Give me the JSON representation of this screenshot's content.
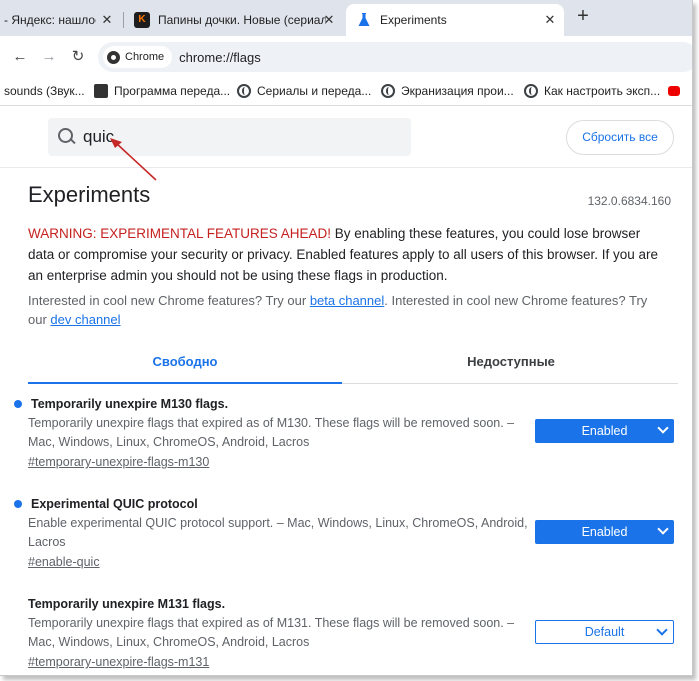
{
  "tabs": [
    {
      "title": "- Яндекс: нашлось",
      "favicon": "yandex-icon"
    },
    {
      "title": "Папины дочки. Новые (сериал",
      "favicon": "kinopoisk-icon"
    },
    {
      "title": "Experiments",
      "favicon": "flask-icon",
      "active": true
    }
  ],
  "toolbar": {
    "chip_label": "Chrome",
    "url": "chrome://flags"
  },
  "bookmarks": [
    {
      "label": "sounds (Звук...",
      "icon": "none"
    },
    {
      "label": "Программа переда...",
      "icon": "tv-icon"
    },
    {
      "label": "Сериалы и переда...",
      "icon": "globe-icon"
    },
    {
      "label": "Экранизация прои...",
      "icon": "globe-icon"
    },
    {
      "label": "Как настроить эксп...",
      "icon": "globe-icon"
    },
    {
      "label": "",
      "icon": "youtube-icon"
    }
  ],
  "search": {
    "value": "quic",
    "reset_label": "Сбросить все"
  },
  "page": {
    "title": "Experiments",
    "version": "132.0.6834.160",
    "warning_red": "WARNING: EXPERIMENTAL FEATURES AHEAD!",
    "warning_rest": " By enabling these features, you could lose browser data or compromise your security or privacy. Enabled features apply to all users of this browser. If you are an enterprise admin you should not be using these flags in production.",
    "promo_1": "Interested in cool new Chrome features? Try our ",
    "beta_link": "beta channel",
    "promo_2": ". Interested in cool new Chrome features? Try our ",
    "dev_link": "dev channel"
  },
  "filter_tabs": {
    "available": "Свободно",
    "unavailable": "Недоступные"
  },
  "flags": [
    {
      "name": "Temporarily unexpire M130 flags.",
      "modified": true,
      "description": "Temporarily unexpire flags that expired as of M130. These flags will be removed soon. – Mac, Windows, Linux, ChromeOS, Android, Lacros",
      "link": "#temporary-unexpire-flags-m130",
      "state": "Enabled"
    },
    {
      "name": "Experimental QUIC protocol",
      "modified": true,
      "description": "Enable experimental QUIC protocol support. – Mac, Windows, Linux, ChromeOS, Android, Lacros",
      "link": "#enable-quic",
      "state": "Enabled"
    },
    {
      "name": "Temporarily unexpire M131 flags.",
      "modified": false,
      "description": "Temporarily unexpire flags that expired as of M131. These flags will be removed soon. – Mac, Windows, Linux, ChromeOS, Android, Lacros",
      "link": "#temporary-unexpire-flags-m131",
      "state": "Default"
    }
  ],
  "colors": {
    "accent": "#1a73e8",
    "warning": "#c5221f",
    "annotation_arrow": "#c62828"
  }
}
